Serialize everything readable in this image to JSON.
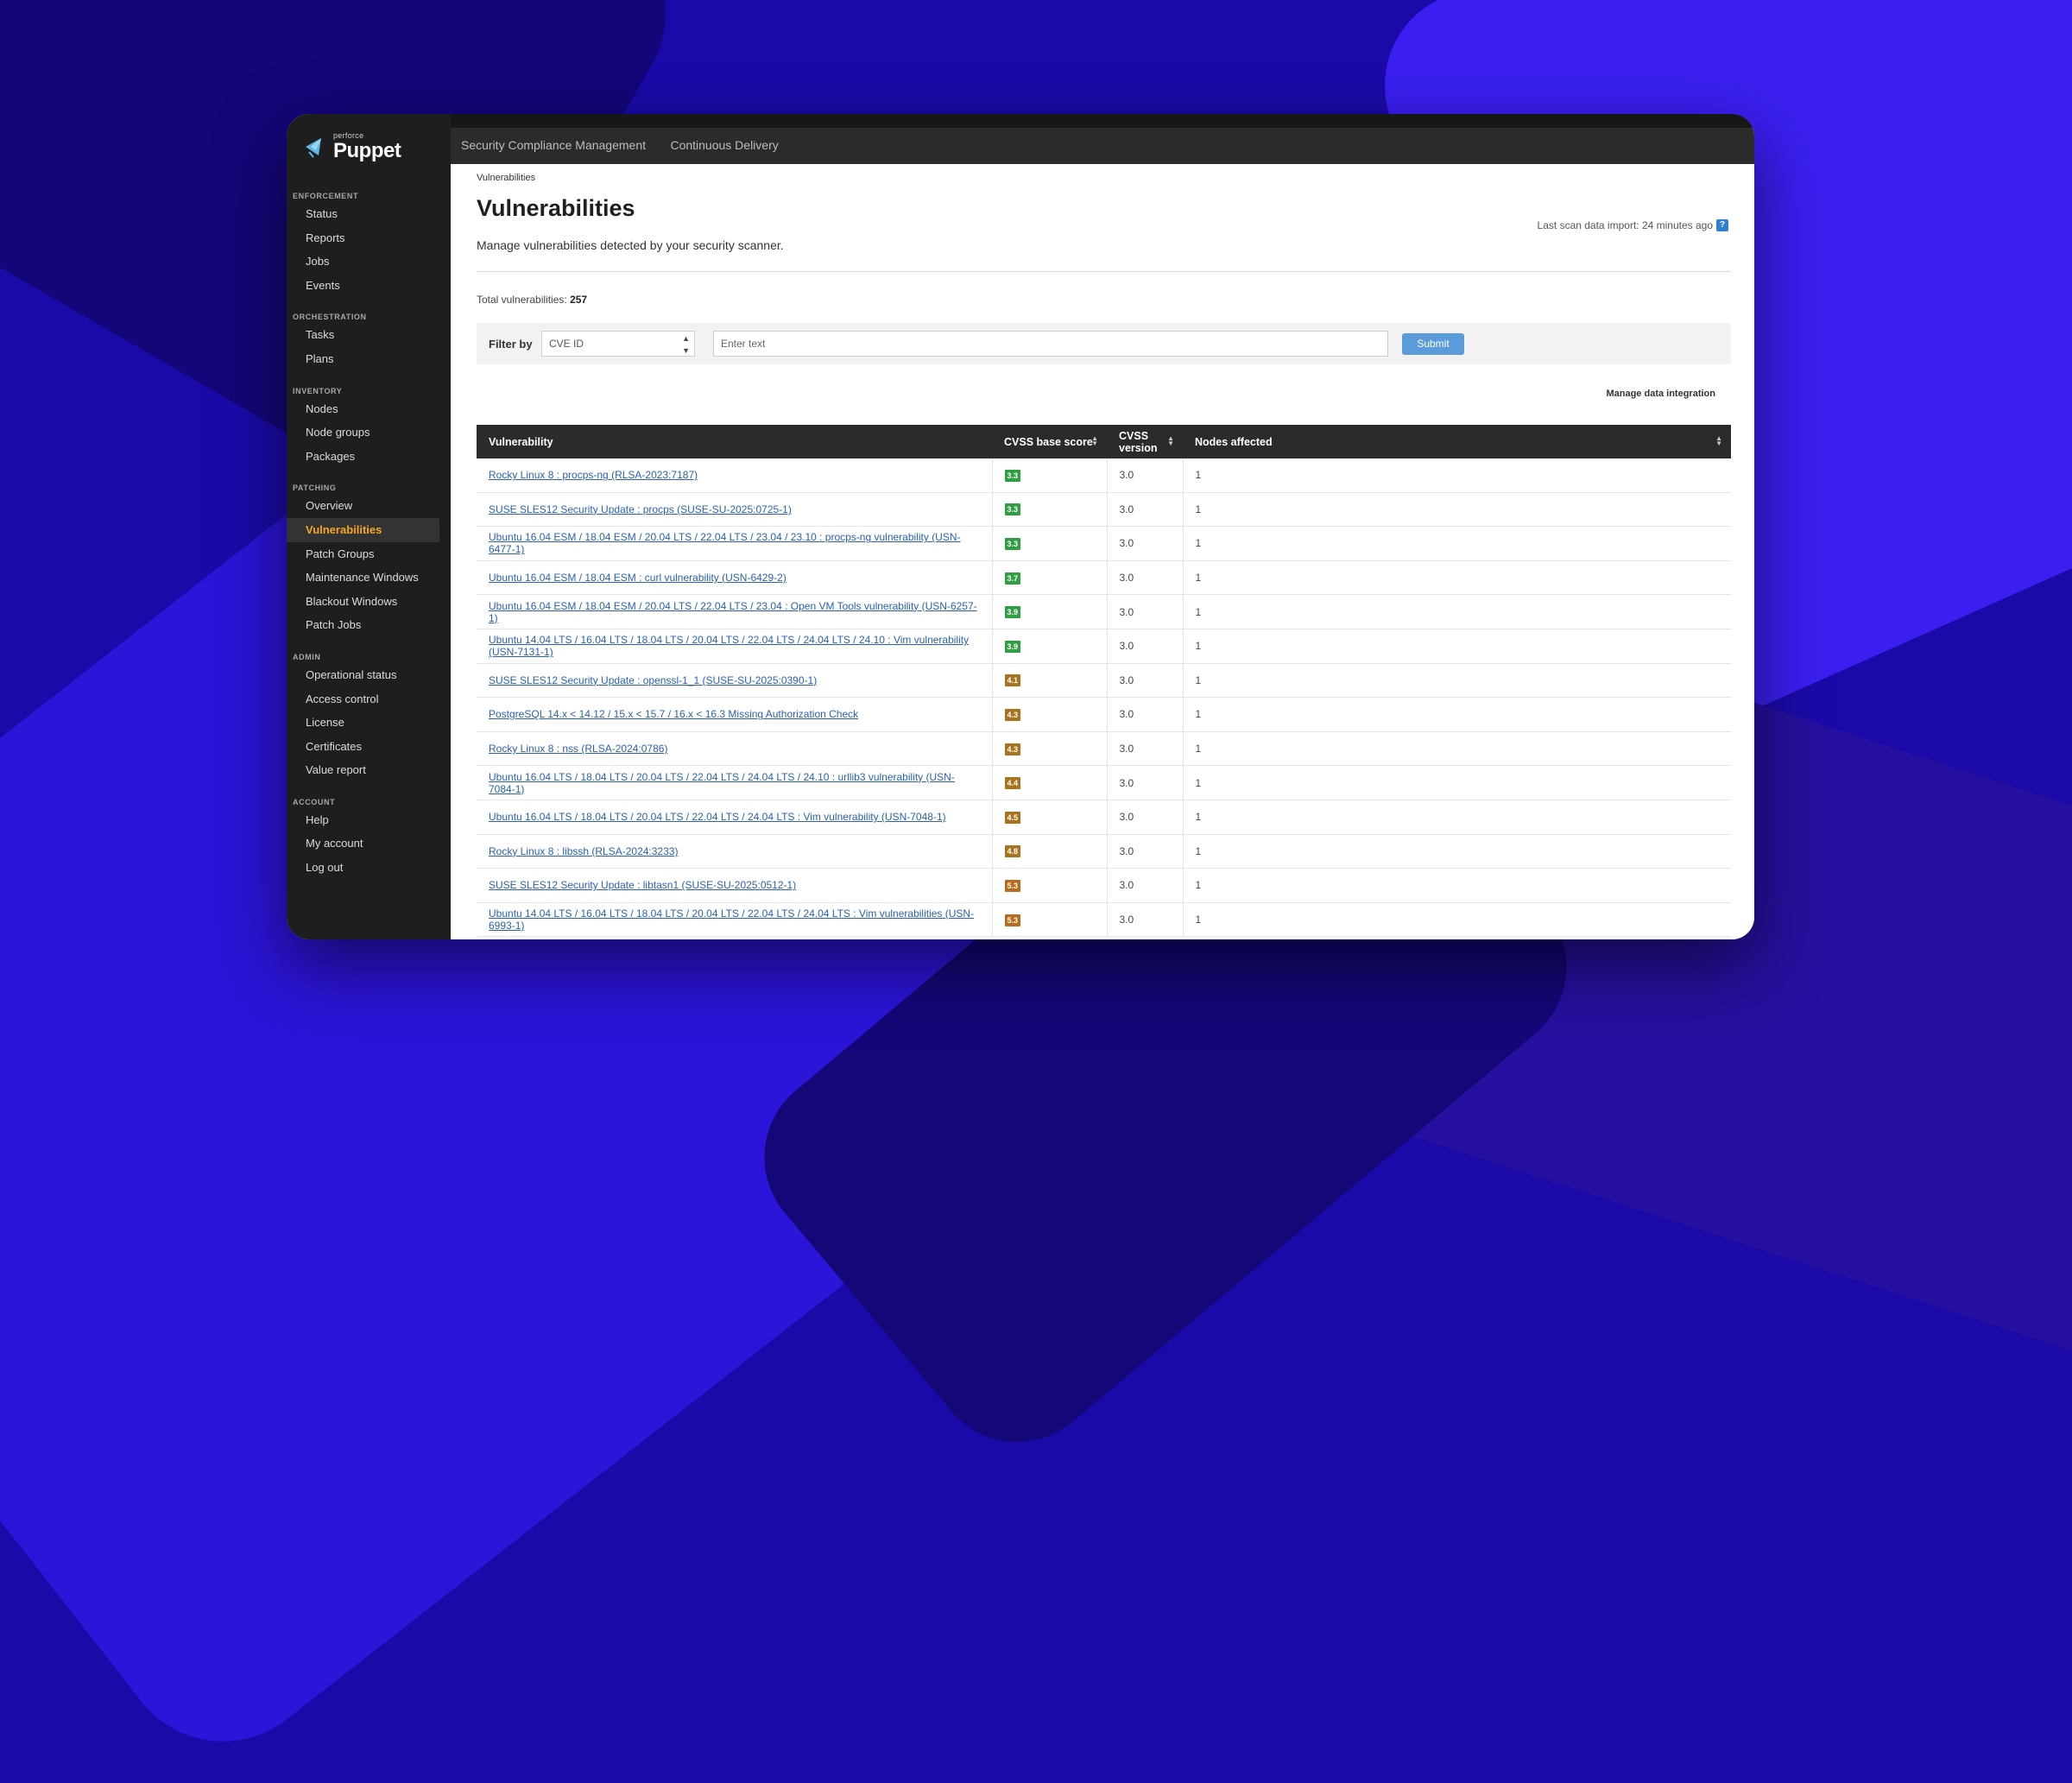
{
  "brand": {
    "small": "perforce",
    "name": "Puppet"
  },
  "sidebar": {
    "sections": [
      {
        "title": "ENFORCEMENT",
        "items": [
          "Status",
          "Reports",
          "Jobs",
          "Events"
        ]
      },
      {
        "title": "ORCHESTRATION",
        "items": [
          "Tasks",
          "Plans"
        ]
      },
      {
        "title": "INVENTORY",
        "items": [
          "Nodes",
          "Node groups",
          "Packages"
        ]
      },
      {
        "title": "PATCHING",
        "items": [
          "Overview",
          "Vulnerabilities",
          "Patch Groups",
          "Maintenance Windows",
          "Blackout Windows",
          "Patch Jobs"
        ]
      },
      {
        "title": "ADMIN",
        "items": [
          "Operational status",
          "Access control",
          "License",
          "Certificates",
          "Value report"
        ]
      },
      {
        "title": "ACCOUNT",
        "items": [
          "Help",
          "My account",
          "Log out"
        ]
      }
    ],
    "active_item": "Vulnerabilities"
  },
  "topbar": {
    "tabs": [
      "Security Compliance Management",
      "Continuous Delivery"
    ]
  },
  "page": {
    "breadcrumb": "Vulnerabilities",
    "title": "Vulnerabilities",
    "subtitle": "Manage vulnerabilities detected by your security scanner.",
    "last_scan": "Last scan data import: 24 minutes ago",
    "total_label": "Total vulnerabilities:",
    "total_value": "257"
  },
  "filter": {
    "label": "Filter by",
    "selected": "CVE ID",
    "placeholder": "Enter text",
    "submit_label": "Submit"
  },
  "manage_label": "Manage data integration",
  "table": {
    "headers": [
      "Vulnerability",
      "CVSS base score",
      "CVSS version",
      "Nodes affected"
    ],
    "rows": [
      {
        "name": "Rocky Linux 8 : procps-ng (RLSA-2023:7187)",
        "score": "3.3",
        "level": "green",
        "version": "3.0",
        "nodes": "1"
      },
      {
        "name": "SUSE SLES12 Security Update : procps (SUSE-SU-2025:0725-1)",
        "score": "3.3",
        "level": "green",
        "version": "3.0",
        "nodes": "1"
      },
      {
        "name": "Ubuntu 16.04 ESM / 18.04 ESM / 20.04 LTS / 22.04 LTS / 23.04 / 23.10 : procps-ng vulnerability (USN-6477-1)",
        "score": "3.3",
        "level": "green",
        "version": "3.0",
        "nodes": "1"
      },
      {
        "name": "Ubuntu 16.04 ESM / 18.04 ESM : curl vulnerability (USN-6429-2)",
        "score": "3.7",
        "level": "green",
        "version": "3.0",
        "nodes": "1"
      },
      {
        "name": "Ubuntu 16.04 ESM / 18.04 ESM / 20.04 LTS / 22.04 LTS / 23.04 : Open VM Tools vulnerability (USN-6257-1)",
        "score": "3.9",
        "level": "green",
        "version": "3.0",
        "nodes": "1"
      },
      {
        "name": "Ubuntu 14.04 LTS / 16.04 LTS / 18.04 LTS / 20.04 LTS / 22.04 LTS / 24.04 LTS / 24.10 : Vim vulnerability (USN-7131-1)",
        "score": "3.9",
        "level": "green",
        "version": "3.0",
        "nodes": "1"
      },
      {
        "name": "SUSE SLES12 Security Update : openssl-1_1 (SUSE-SU-2025:0390-1)",
        "score": "4.1",
        "level": "amber",
        "version": "3.0",
        "nodes": "1"
      },
      {
        "name": "PostgreSQL 14.x < 14.12 / 15.x < 15.7 / 16.x < 16.3 Missing Authorization Check",
        "score": "4.3",
        "level": "amber",
        "version": "3.0",
        "nodes": "1"
      },
      {
        "name": "Rocky Linux 8 : nss (RLSA-2024:0786)",
        "score": "4.3",
        "level": "amber",
        "version": "3.0",
        "nodes": "1"
      },
      {
        "name": "Ubuntu 16.04 LTS / 18.04 LTS / 20.04 LTS / 22.04 LTS / 24.04 LTS / 24.10 : urllib3 vulnerability (USN-7084-1)",
        "score": "4.4",
        "level": "amber",
        "version": "3.0",
        "nodes": "1"
      },
      {
        "name": "Ubuntu 16.04 LTS / 18.04 LTS / 20.04 LTS / 22.04 LTS / 24.04 LTS : Vim vulnerability (USN-7048-1)",
        "score": "4.5",
        "level": "amber",
        "version": "3.0",
        "nodes": "1"
      },
      {
        "name": "Rocky Linux 8 : libssh (RLSA-2024:3233)",
        "score": "4.8",
        "level": "amber",
        "version": "3.0",
        "nodes": "1"
      },
      {
        "name": "SUSE SLES12 Security Update : libtasn1 (SUSE-SU-2025:0512-1)",
        "score": "5.3",
        "level": "brown",
        "version": "3.0",
        "nodes": "1"
      },
      {
        "name": "Ubuntu 14.04 LTS / 16.04 LTS / 18.04 LTS / 20.04 LTS / 22.04 LTS / 24.04 LTS : Vim vulnerabilities (USN-6993-1)",
        "score": "5.3",
        "level": "brown",
        "version": "3.0",
        "nodes": "1"
      }
    ]
  },
  "colors": {
    "background": "#1b0aa8",
    "sidebar": "#1e1e1e",
    "active_nav": "#f5a623",
    "link": "#2a61b3",
    "submit": "#5b9bd9",
    "badge_green": "#2f9e44",
    "badge_amber": "#a8731f",
    "badge_brown": "#b96a1a"
  }
}
